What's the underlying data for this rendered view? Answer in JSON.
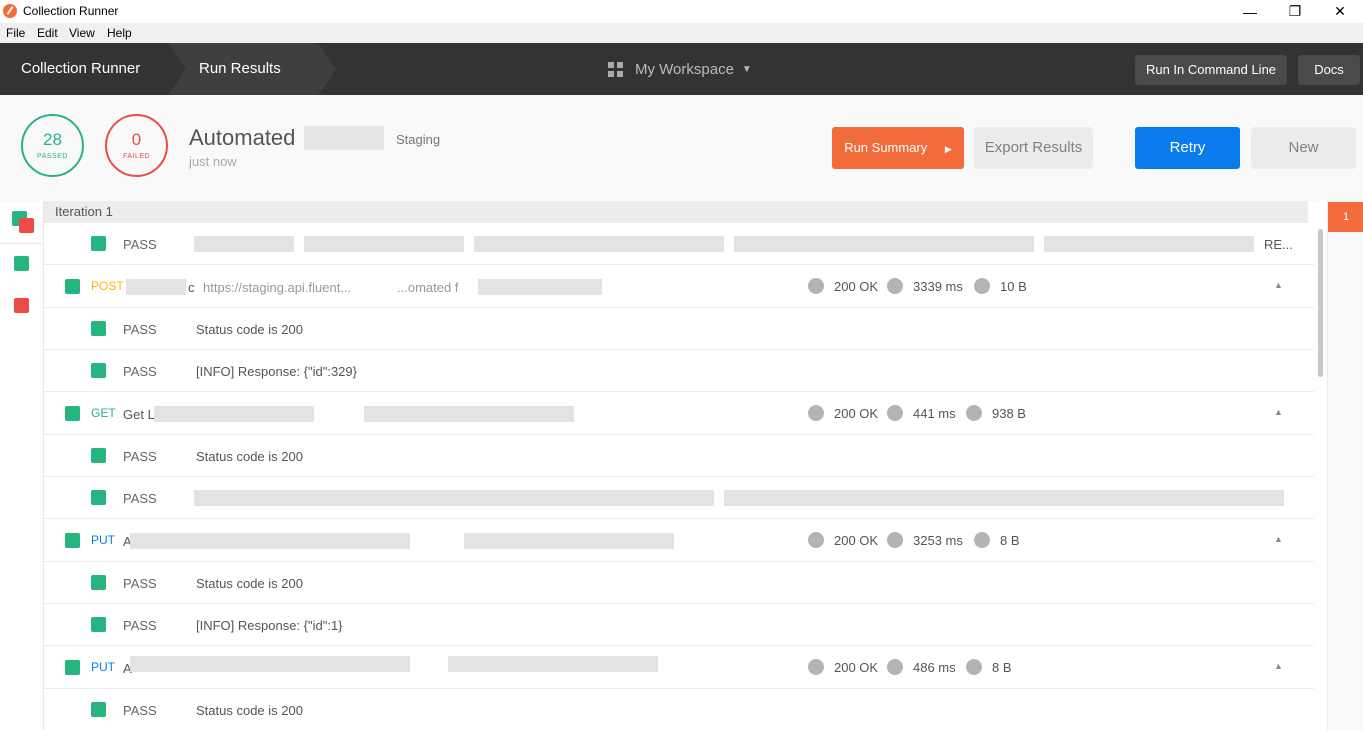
{
  "window": {
    "title": "Collection Runner",
    "minimize": "—",
    "maximize": "❐",
    "close": "✕"
  },
  "menu": [
    "File",
    "Edit",
    "View",
    "Help"
  ],
  "header": {
    "crumb1": "Collection Runner",
    "crumb2": "Run Results",
    "workspace": "My Workspace",
    "cmd_button": "Run In Command Line",
    "docs_button": "Docs"
  },
  "summary": {
    "passed_count": "28",
    "passed_label": "PASSED",
    "failed_count": "0",
    "failed_label": "FAILED",
    "run_name": "Automated",
    "environment": "Staging",
    "time": "just now",
    "run_summary": "Run Summary",
    "export": "Export Results",
    "retry": "Retry",
    "new": "New"
  },
  "iteration": {
    "label": "Iteration 1",
    "badge": "1"
  },
  "rows": {
    "r0": {
      "status": "PASS",
      "msg_tail": "RE..."
    },
    "req1": {
      "method": "POST",
      "name": "c",
      "url": "https://staging.api.fluent...",
      "url2": "...omated f",
      "code": "200 OK",
      "time": "3339 ms",
      "size": "10 B"
    },
    "r1a": {
      "status": "PASS",
      "msg": "Status code is 200"
    },
    "r1b": {
      "status": "PASS",
      "msg": "[INFO] Response: {\"id\":329}"
    },
    "req2": {
      "method": "GET",
      "name": "Get L",
      "code": "200 OK",
      "time": "441 ms",
      "size": "938 B"
    },
    "r2a": {
      "status": "PASS",
      "msg": "Status code is 200"
    },
    "r2b": {
      "status": "PASS"
    },
    "req3": {
      "method": "PUT",
      "name": "A",
      "code": "200 OK",
      "time": "3253 ms",
      "size": "8 B"
    },
    "r3a": {
      "status": "PASS",
      "msg": "Status code is 200"
    },
    "r3b": {
      "status": "PASS",
      "msg": "[INFO] Response: {\"id\":1}"
    },
    "req4": {
      "method": "PUT",
      "name": "A",
      "code": "200 OK",
      "time": "486 ms",
      "size": "8 B"
    },
    "r4a": {
      "status": "PASS",
      "msg": "Status code is 200"
    }
  },
  "colors": {
    "pass": "#26b47f",
    "fail": "#ed4b48",
    "accent": "#f26b3a",
    "blue": "#097bed",
    "post": "#ffb400",
    "get": "#26b47f",
    "put": "#097bed"
  }
}
